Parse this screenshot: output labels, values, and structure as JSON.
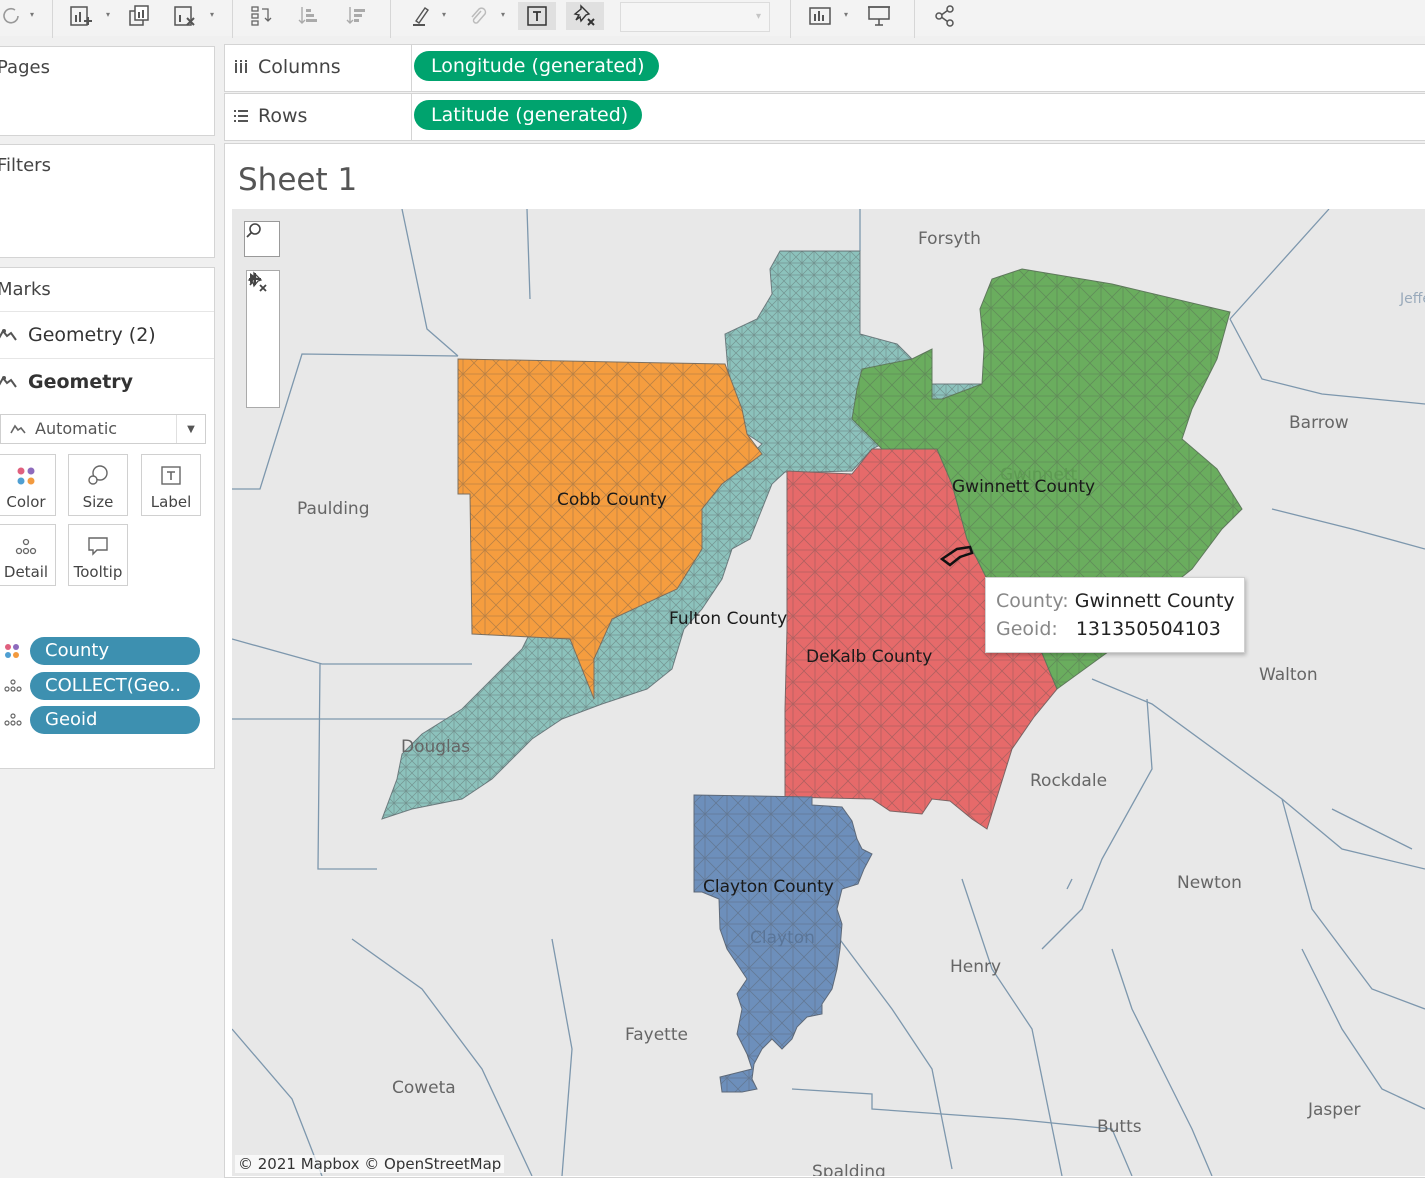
{
  "toolbar": {
    "icons": [
      "redo-icon",
      "new-worksheet-icon",
      "duplicate-icon",
      "clear-sheet-icon",
      "swap-icon",
      "sort-ascending-icon",
      "sort-descending-icon",
      "highlight-icon",
      "paperclip-icon",
      "show-labels-icon",
      "pin-clear-icon",
      "show-me-icon",
      "presentation-icon",
      "share-icon"
    ]
  },
  "shelves": {
    "pages": "Pages",
    "filters": "Filters",
    "columns": {
      "label": "Columns",
      "pill": "Longitude (generated)"
    },
    "rows": {
      "label": "Rows",
      "pill": "Latitude (generated)"
    }
  },
  "marks": {
    "title": "Marks",
    "layers": [
      "Geometry (2)",
      "Geometry"
    ],
    "mark_type": "Automatic",
    "cards": {
      "color": "Color",
      "size": "Size",
      "label": "Label",
      "detail": "Detail",
      "tooltip": "Tooltip"
    },
    "pills": [
      {
        "name": "County",
        "icon": "color-dots-icon"
      },
      {
        "name": "COLLECT(Geo..",
        "icon": "detail-dots-icon"
      },
      {
        "name": "Geoid",
        "icon": "detail-dots-icon"
      }
    ]
  },
  "sheet": {
    "title": "Sheet 1",
    "attribution": "© 2021 Mapbox © OpenStreetMap"
  },
  "map": {
    "places": [
      "Forsyth",
      "Jeffe",
      "Barrow",
      "Paulding",
      "Walton",
      "Douglas",
      "Rockdale",
      "Newton",
      "Henry",
      "Fayette",
      "Coweta",
      "Butts",
      "Jasper",
      "Spalding",
      "Clayton",
      "Gwinnett"
    ],
    "counties": [
      {
        "name": "Cobb County",
        "color": "#f59d3f"
      },
      {
        "name": "Fulton County",
        "color": "#8cc2bc"
      },
      {
        "name": "DeKalb County",
        "color": "#e66a6a"
      },
      {
        "name": "Gwinnett County",
        "color": "#6aad5e"
      },
      {
        "name": "Clayton County",
        "color": "#6d8fbb"
      }
    ]
  },
  "tooltip": {
    "county_key": "County:",
    "county_value": "Gwinnett County",
    "geoid_key": "Geoid:",
    "geoid_value": "131350504103"
  }
}
